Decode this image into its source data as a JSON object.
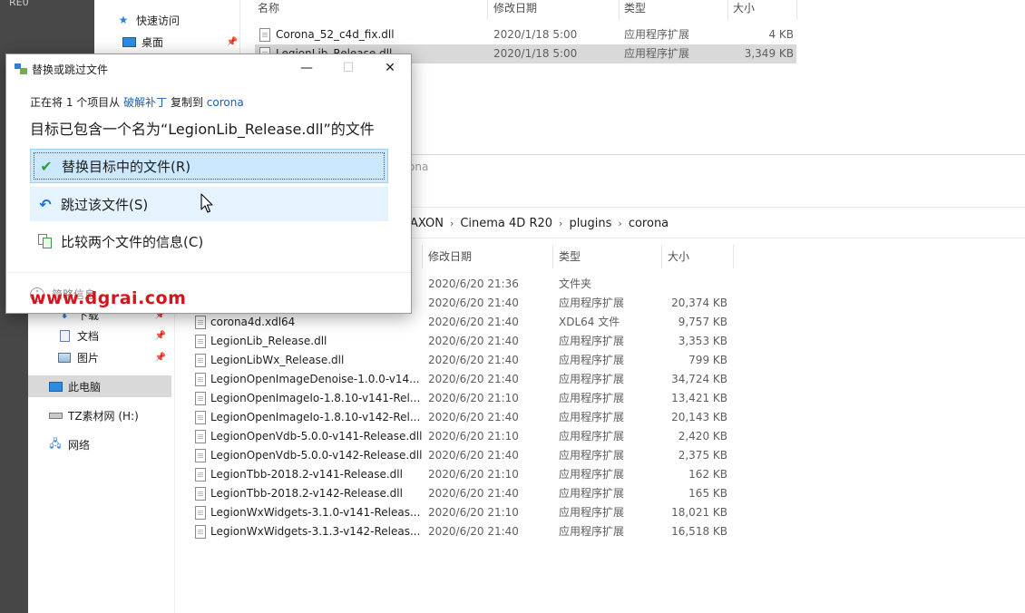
{
  "corner_label": "RE0",
  "top_window": {
    "nav": [
      {
        "label": "快速访问",
        "icon": "star-icon"
      },
      {
        "label": "桌面",
        "icon": "desktop-icon"
      }
    ],
    "columns": [
      "名称",
      "修改日期",
      "类型",
      "大小"
    ],
    "rows": [
      {
        "name": "Corona_52_c4d_fix.dll",
        "date": "2020/1/18 5:00",
        "type": "应用程序扩展",
        "size": "4 KB",
        "selected": false
      },
      {
        "name": "LegionLib_Release.dll",
        "date": "2020/1/18 5:00",
        "type": "应用程序扩展",
        "size": "3,349 KB",
        "selected": true
      }
    ]
  },
  "bottom_window": {
    "title_fragment": "ona",
    "breadcrumb": [
      "AXON",
      "Cinema 4D R20",
      "plugins",
      "corona"
    ],
    "nav": [
      {
        "label": "下载",
        "icon": "download-icon",
        "pinned": true
      },
      {
        "label": "文档",
        "icon": "document-icon",
        "pinned": true
      },
      {
        "label": "图片",
        "icon": "picture-icon",
        "pinned": true
      },
      {
        "label": "此电脑",
        "icon": "computer-icon",
        "selected": true
      },
      {
        "label": "TZ素材网 (H:)",
        "icon": "drive-icon"
      },
      {
        "label": "网络",
        "icon": "network-icon"
      }
    ],
    "columns": [
      "修改日期",
      "类型",
      "大小"
    ],
    "rows": [
      {
        "name": "",
        "date": "2020/6/20 21:36",
        "type": "文件夹",
        "size": ""
      },
      {
        "name": "",
        "date": "2020/6/20 21:40",
        "type": "应用程序扩展",
        "size": "20,374 KB"
      },
      {
        "name": "corona4d.xdl64",
        "date": "2020/6/20 21:40",
        "type": "XDL64 文件",
        "size": "9,757 KB"
      },
      {
        "name": "LegionLib_Release.dll",
        "date": "2020/6/20 21:40",
        "type": "应用程序扩展",
        "size": "3,353 KB"
      },
      {
        "name": "LegionLibWx_Release.dll",
        "date": "2020/6/20 21:40",
        "type": "应用程序扩展",
        "size": "799 KB"
      },
      {
        "name": "LegionOpenImageDenoise-1.0.0-v14...",
        "date": "2020/6/20 21:40",
        "type": "应用程序扩展",
        "size": "34,724 KB"
      },
      {
        "name": "LegionOpenImageIo-1.8.10-v141-Rel...",
        "date": "2020/6/20 21:10",
        "type": "应用程序扩展",
        "size": "13,421 KB"
      },
      {
        "name": "LegionOpenImageIo-1.8.10-v142-Rel...",
        "date": "2020/6/20 21:40",
        "type": "应用程序扩展",
        "size": "20,143 KB"
      },
      {
        "name": "LegionOpenVdb-5.0.0-v141-Release.dll",
        "date": "2020/6/20 21:10",
        "type": "应用程序扩展",
        "size": "2,420 KB"
      },
      {
        "name": "LegionOpenVdb-5.0.0-v142-Release.dll",
        "date": "2020/6/20 21:40",
        "type": "应用程序扩展",
        "size": "2,375 KB"
      },
      {
        "name": "LegionTbb-2018.2-v141-Release.dll",
        "date": "2020/6/20 21:10",
        "type": "应用程序扩展",
        "size": "162 KB"
      },
      {
        "name": "LegionTbb-2018.2-v142-Release.dll",
        "date": "2020/6/20 21:40",
        "type": "应用程序扩展",
        "size": "165 KB"
      },
      {
        "name": "LegionWxWidgets-3.1.0-v141-Releas...",
        "date": "2020/6/20 21:10",
        "type": "应用程序扩展",
        "size": "18,021 KB"
      },
      {
        "name": "LegionWxWidgets-3.1.3-v142-Releas...",
        "date": "2020/6/20 21:40",
        "type": "应用程序扩展",
        "size": "16,518 KB"
      }
    ]
  },
  "dialog": {
    "title": "替换或跳过文件",
    "line1_prefix": "正在将 1 个项目从",
    "source": "破解补丁",
    "line1_middle": "复制到",
    "destination": "corona",
    "message": "目标已包含一个名为“LegionLib_Release.dll”的文件",
    "options": [
      {
        "label": "替换目标中的文件(R)",
        "icon": "checkmark-icon",
        "state": "selected"
      },
      {
        "label": "跳过该文件(S)",
        "icon": "skip-arrow-icon",
        "state": "hover"
      },
      {
        "label": "比较两个文件的信息(C)",
        "icon": "compare-icon",
        "state": "normal"
      }
    ],
    "footer": "简略信息"
  },
  "watermark": "www.dgrai.com",
  "colors": {
    "accent": "#cce8ff",
    "link": "#1c5fb3",
    "watermark": "#d6141b"
  }
}
